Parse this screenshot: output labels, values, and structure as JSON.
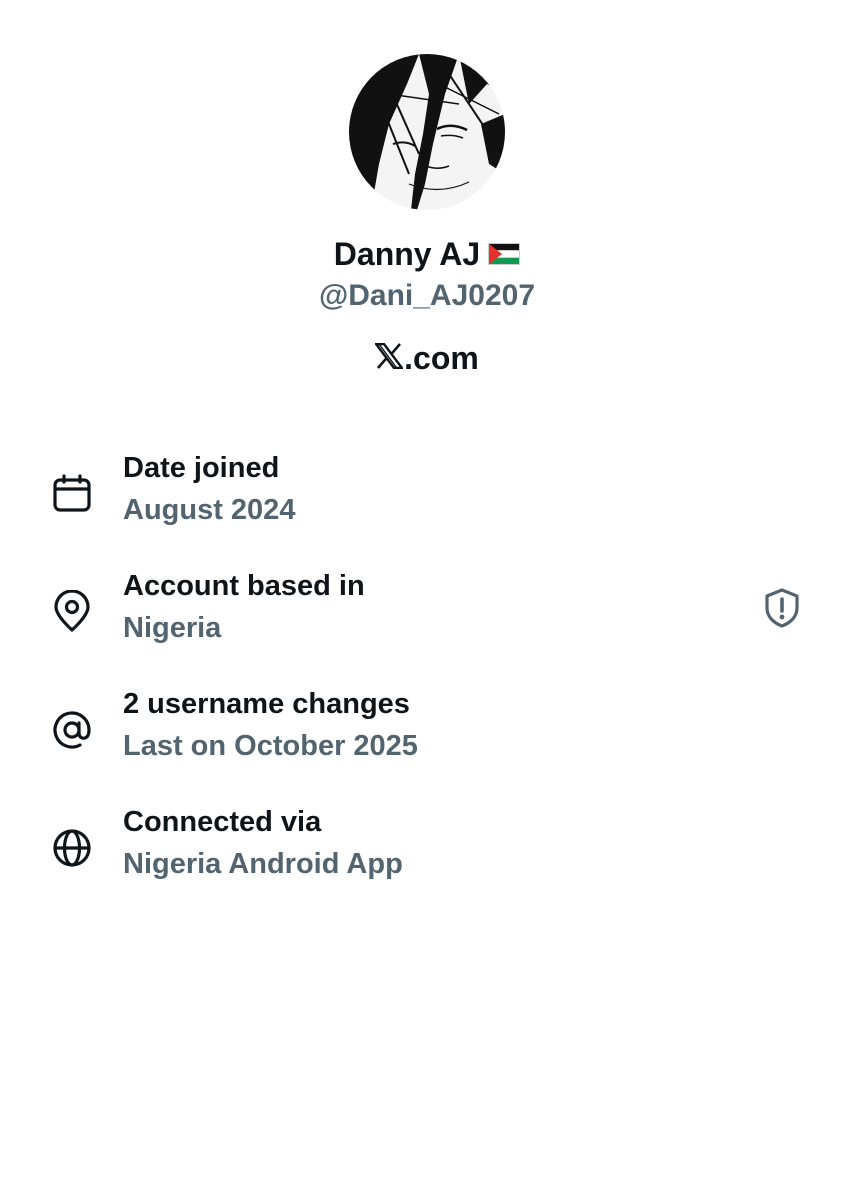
{
  "profile": {
    "name": "Danny AJ",
    "flag_icon": "palestine-flag-icon",
    "handle": "@Dani_AJ0207",
    "brand_mark": "x-logo-icon",
    "brand_suffix": ".com"
  },
  "details": [
    {
      "icon": "calendar-icon",
      "title": "Date joined",
      "value": "August 2024"
    },
    {
      "icon": "location-pin-icon",
      "title": "Account based in",
      "value": "Nigeria",
      "badge_icon": "shield-alert-icon"
    },
    {
      "icon": "at-sign-icon",
      "title": "2 username changes",
      "value": "Last on October 2025"
    },
    {
      "icon": "globe-icon",
      "title": "Connected via",
      "value": "Nigeria Android App"
    }
  ],
  "colors": {
    "primary_text": "#0f1419",
    "secondary_text": "#536471",
    "background": "#ffffff"
  }
}
